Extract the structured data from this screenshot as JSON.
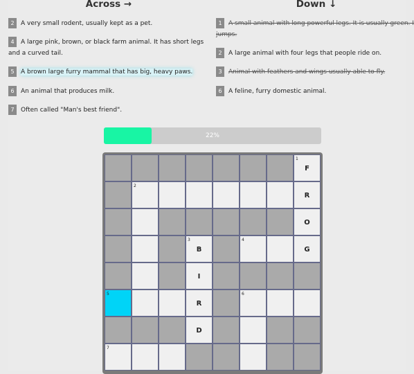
{
  "across_heading": "Across →",
  "down_heading": "Down ↓",
  "across": [
    {
      "num": "2",
      "text": "A very small rodent, usually kept as a pet.",
      "state": "normal"
    },
    {
      "num": "4",
      "text": "A large pink, brown, or black farm animal. It has short legs",
      "text2": "and a curved tail.",
      "state": "normal"
    },
    {
      "num": "5",
      "text": "A brown large furry mammal that has big, heavy paws.",
      "state": "active"
    },
    {
      "num": "6",
      "text": "An animal that produces milk.",
      "state": "normal"
    },
    {
      "num": "7",
      "text": "Often called \"Man's best friend\".",
      "state": "normal"
    }
  ],
  "down": [
    {
      "num": "1",
      "text": "A small animal with long powerful legs. It is usually green. It",
      "text2": "jumps.",
      "state": "done"
    },
    {
      "num": "2",
      "text": "A large animal with four legs that people ride on.",
      "state": "normal"
    },
    {
      "num": "3",
      "text": "Animal with feathers and wings usually able to fly.",
      "state": "done"
    },
    {
      "num": "6",
      "text": "A feline, furry domestic animal.",
      "state": "normal"
    }
  ],
  "progress": {
    "value": 0.22,
    "label": "22%"
  },
  "colors": {
    "selected": "#00d4f7",
    "progress": "#18f5a4",
    "block": "#aaaaaa",
    "open": "#f0f0f0"
  },
  "grid": [
    [
      {
        "t": "b"
      },
      {
        "t": "b"
      },
      {
        "t": "b"
      },
      {
        "t": "b"
      },
      {
        "t": "b"
      },
      {
        "t": "b"
      },
      {
        "t": "b"
      },
      {
        "t": "w",
        "n": "1",
        "l": "F"
      }
    ],
    [
      {
        "t": "b"
      },
      {
        "t": "w",
        "n": "2"
      },
      {
        "t": "w"
      },
      {
        "t": "w"
      },
      {
        "t": "w"
      },
      {
        "t": "w"
      },
      {
        "t": "w"
      },
      {
        "t": "w",
        "l": "R"
      }
    ],
    [
      {
        "t": "b"
      },
      {
        "t": "w"
      },
      {
        "t": "b"
      },
      {
        "t": "b"
      },
      {
        "t": "b"
      },
      {
        "t": "b"
      },
      {
        "t": "b"
      },
      {
        "t": "w",
        "l": "O"
      }
    ],
    [
      {
        "t": "b"
      },
      {
        "t": "w"
      },
      {
        "t": "b"
      },
      {
        "t": "w",
        "n": "3",
        "l": "B"
      },
      {
        "t": "b"
      },
      {
        "t": "w",
        "n": "4"
      },
      {
        "t": "w"
      },
      {
        "t": "w",
        "l": "G"
      }
    ],
    [
      {
        "t": "b"
      },
      {
        "t": "w"
      },
      {
        "t": "b"
      },
      {
        "t": "w",
        "l": "I"
      },
      {
        "t": "b"
      },
      {
        "t": "b"
      },
      {
        "t": "b"
      },
      {
        "t": "b"
      }
    ],
    [
      {
        "t": "s",
        "n": "5"
      },
      {
        "t": "w"
      },
      {
        "t": "w"
      },
      {
        "t": "w",
        "l": "R"
      },
      {
        "t": "b"
      },
      {
        "t": "w",
        "n": "6"
      },
      {
        "t": "w"
      },
      {
        "t": "w"
      }
    ],
    [
      {
        "t": "b"
      },
      {
        "t": "b"
      },
      {
        "t": "b"
      },
      {
        "t": "w",
        "l": "D"
      },
      {
        "t": "b"
      },
      {
        "t": "w"
      },
      {
        "t": "b"
      },
      {
        "t": "b"
      }
    ],
    [
      {
        "t": "w",
        "n": "7"
      },
      {
        "t": "w"
      },
      {
        "t": "w"
      },
      {
        "t": "b"
      },
      {
        "t": "b"
      },
      {
        "t": "w"
      },
      {
        "t": "b"
      },
      {
        "t": "b"
      }
    ]
  ]
}
